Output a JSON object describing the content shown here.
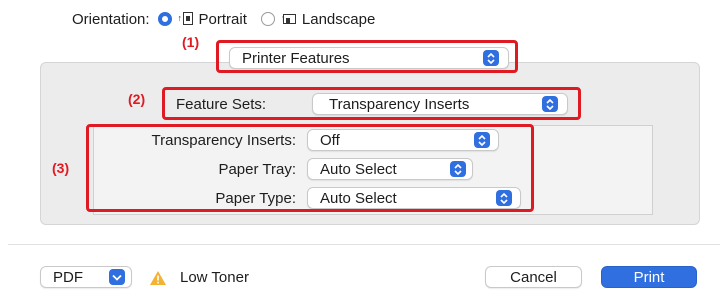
{
  "orientation": {
    "label": "Orientation:",
    "options": [
      {
        "label": "Portrait",
        "selected": true,
        "icon": "portrait-page-icon"
      },
      {
        "label": "Landscape",
        "selected": false,
        "icon": "landscape-page-icon"
      }
    ]
  },
  "callouts": [
    "(1)",
    "(2)",
    "(3)"
  ],
  "panel_select": {
    "value": "Printer Features"
  },
  "feature_sets": {
    "label": "Feature Sets:",
    "value": "Transparency Inserts"
  },
  "options": [
    {
      "label": "Transparency Inserts:",
      "value": "Off"
    },
    {
      "label": "Paper Tray:",
      "value": "Auto Select"
    },
    {
      "label": "Paper Type:",
      "value": "Auto Select"
    }
  ],
  "footer": {
    "pdf_label": "PDF",
    "status_text": "Low Toner",
    "status_icon": "warning-triangle-icon",
    "cancel_label": "Cancel",
    "print_label": "Print"
  },
  "colors": {
    "accent": "#2f6fdf",
    "annotation": "#e01a22",
    "warning": "#f2b233"
  }
}
